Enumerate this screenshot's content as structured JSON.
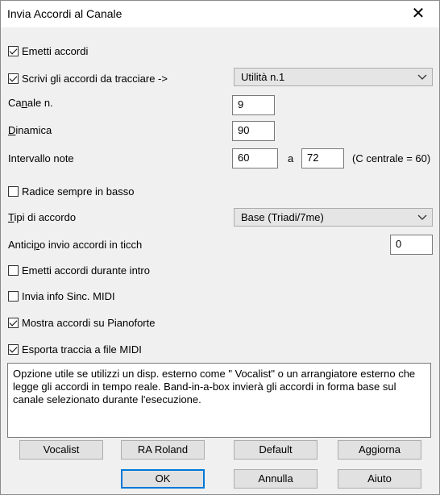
{
  "window": {
    "title": "Invia Accordi al Canale"
  },
  "options": {
    "emit_chords": {
      "label": "Emetti accordi",
      "checked": true
    },
    "write_chords": {
      "label": "Scrivi gli accordi da tracciare ->",
      "checked": true,
      "track_value": "Utilità n.1"
    },
    "channel": {
      "label_pre": "Ca",
      "label_u": "n",
      "label_post": "ale n.",
      "value": "9"
    },
    "dynamics": {
      "label_u": "D",
      "label_post": "inamica",
      "value": "90"
    },
    "note_range": {
      "label": "Intervallo note",
      "low": "60",
      "sep": "a",
      "high": "72",
      "note": "(C centrale = 60)"
    },
    "root_bass": {
      "label": "Radice sempre in basso",
      "checked": false
    },
    "chord_types": {
      "label_u": "T",
      "label_post": "ipi di accordo",
      "value": "Base (Triadi/7me)"
    },
    "anticipate": {
      "label_pre": "Antici",
      "label_u": "p",
      "label_post": "o invio accordi in ticch",
      "value": "0"
    },
    "intro_chords": {
      "label": "Emetti accordi durante intro",
      "checked": false
    },
    "midi_sync": {
      "label": "Invia info Sinc. MIDI",
      "checked": false
    },
    "show_piano": {
      "label": "Mostra accordi su Pianoforte",
      "checked": true
    },
    "export_midi": {
      "label": "Esporta traccia a file MIDI",
      "checked": true
    }
  },
  "description": "Opzione utile se utilizzi un disp. esterno come \" Vocalist\" o un arrangiatore esterno che legge gli accordi in tempo reale. Band-in-a-box invierà gli accordi in forma base sul canale selezionato durante l'esecuzione.",
  "buttons": {
    "vocalist": "Vocalist",
    "roland": "RA Roland",
    "default": "Default",
    "update": "Aggiorna",
    "ok": "OK",
    "cancel": "Annulla",
    "help": "Aiuto"
  }
}
